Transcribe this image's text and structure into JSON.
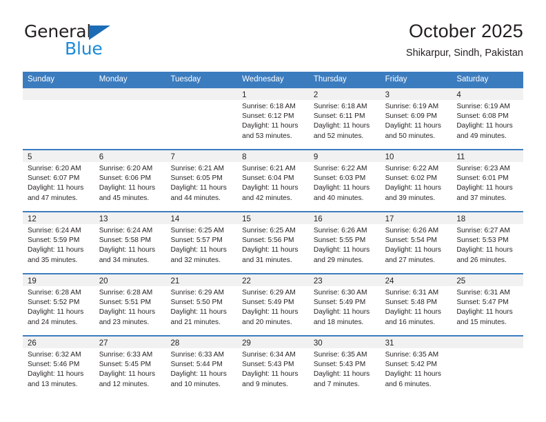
{
  "brand": {
    "name_top": "General",
    "name_bottom": "Blue",
    "accent_color": "#1b8ad6",
    "triangle_color": "#1b6cb5"
  },
  "header": {
    "title": "October 2025",
    "subtitle": "Shikarpur, Sindh, Pakistan"
  },
  "theme": {
    "header_row_bg": "#3b7cbf",
    "day_strip_bg": "#f1f1f1",
    "text_color": "#231f20"
  },
  "weekdays": [
    "Sunday",
    "Monday",
    "Tuesday",
    "Wednesday",
    "Thursday",
    "Friday",
    "Saturday"
  ],
  "weeks": [
    [
      {
        "day": "",
        "empty": true
      },
      {
        "day": "",
        "empty": true
      },
      {
        "day": "",
        "empty": true
      },
      {
        "day": "1",
        "sunrise": "Sunrise: 6:18 AM",
        "sunset": "Sunset: 6:12 PM",
        "daylight1": "Daylight: 11 hours",
        "daylight2": "and 53 minutes."
      },
      {
        "day": "2",
        "sunrise": "Sunrise: 6:18 AM",
        "sunset": "Sunset: 6:11 PM",
        "daylight1": "Daylight: 11 hours",
        "daylight2": "and 52 minutes."
      },
      {
        "day": "3",
        "sunrise": "Sunrise: 6:19 AM",
        "sunset": "Sunset: 6:09 PM",
        "daylight1": "Daylight: 11 hours",
        "daylight2": "and 50 minutes."
      },
      {
        "day": "4",
        "sunrise": "Sunrise: 6:19 AM",
        "sunset": "Sunset: 6:08 PM",
        "daylight1": "Daylight: 11 hours",
        "daylight2": "and 49 minutes."
      }
    ],
    [
      {
        "day": "5",
        "sunrise": "Sunrise: 6:20 AM",
        "sunset": "Sunset: 6:07 PM",
        "daylight1": "Daylight: 11 hours",
        "daylight2": "and 47 minutes."
      },
      {
        "day": "6",
        "sunrise": "Sunrise: 6:20 AM",
        "sunset": "Sunset: 6:06 PM",
        "daylight1": "Daylight: 11 hours",
        "daylight2": "and 45 minutes."
      },
      {
        "day": "7",
        "sunrise": "Sunrise: 6:21 AM",
        "sunset": "Sunset: 6:05 PM",
        "daylight1": "Daylight: 11 hours",
        "daylight2": "and 44 minutes."
      },
      {
        "day": "8",
        "sunrise": "Sunrise: 6:21 AM",
        "sunset": "Sunset: 6:04 PM",
        "daylight1": "Daylight: 11 hours",
        "daylight2": "and 42 minutes."
      },
      {
        "day": "9",
        "sunrise": "Sunrise: 6:22 AM",
        "sunset": "Sunset: 6:03 PM",
        "daylight1": "Daylight: 11 hours",
        "daylight2": "and 40 minutes."
      },
      {
        "day": "10",
        "sunrise": "Sunrise: 6:22 AM",
        "sunset": "Sunset: 6:02 PM",
        "daylight1": "Daylight: 11 hours",
        "daylight2": "and 39 minutes."
      },
      {
        "day": "11",
        "sunrise": "Sunrise: 6:23 AM",
        "sunset": "Sunset: 6:01 PM",
        "daylight1": "Daylight: 11 hours",
        "daylight2": "and 37 minutes."
      }
    ],
    [
      {
        "day": "12",
        "sunrise": "Sunrise: 6:24 AM",
        "sunset": "Sunset: 5:59 PM",
        "daylight1": "Daylight: 11 hours",
        "daylight2": "and 35 minutes."
      },
      {
        "day": "13",
        "sunrise": "Sunrise: 6:24 AM",
        "sunset": "Sunset: 5:58 PM",
        "daylight1": "Daylight: 11 hours",
        "daylight2": "and 34 minutes."
      },
      {
        "day": "14",
        "sunrise": "Sunrise: 6:25 AM",
        "sunset": "Sunset: 5:57 PM",
        "daylight1": "Daylight: 11 hours",
        "daylight2": "and 32 minutes."
      },
      {
        "day": "15",
        "sunrise": "Sunrise: 6:25 AM",
        "sunset": "Sunset: 5:56 PM",
        "daylight1": "Daylight: 11 hours",
        "daylight2": "and 31 minutes."
      },
      {
        "day": "16",
        "sunrise": "Sunrise: 6:26 AM",
        "sunset": "Sunset: 5:55 PM",
        "daylight1": "Daylight: 11 hours",
        "daylight2": "and 29 minutes."
      },
      {
        "day": "17",
        "sunrise": "Sunrise: 6:26 AM",
        "sunset": "Sunset: 5:54 PM",
        "daylight1": "Daylight: 11 hours",
        "daylight2": "and 27 minutes."
      },
      {
        "day": "18",
        "sunrise": "Sunrise: 6:27 AM",
        "sunset": "Sunset: 5:53 PM",
        "daylight1": "Daylight: 11 hours",
        "daylight2": "and 26 minutes."
      }
    ],
    [
      {
        "day": "19",
        "sunrise": "Sunrise: 6:28 AM",
        "sunset": "Sunset: 5:52 PM",
        "daylight1": "Daylight: 11 hours",
        "daylight2": "and 24 minutes."
      },
      {
        "day": "20",
        "sunrise": "Sunrise: 6:28 AM",
        "sunset": "Sunset: 5:51 PM",
        "daylight1": "Daylight: 11 hours",
        "daylight2": "and 23 minutes."
      },
      {
        "day": "21",
        "sunrise": "Sunrise: 6:29 AM",
        "sunset": "Sunset: 5:50 PM",
        "daylight1": "Daylight: 11 hours",
        "daylight2": "and 21 minutes."
      },
      {
        "day": "22",
        "sunrise": "Sunrise: 6:29 AM",
        "sunset": "Sunset: 5:49 PM",
        "daylight1": "Daylight: 11 hours",
        "daylight2": "and 20 minutes."
      },
      {
        "day": "23",
        "sunrise": "Sunrise: 6:30 AM",
        "sunset": "Sunset: 5:49 PM",
        "daylight1": "Daylight: 11 hours",
        "daylight2": "and 18 minutes."
      },
      {
        "day": "24",
        "sunrise": "Sunrise: 6:31 AM",
        "sunset": "Sunset: 5:48 PM",
        "daylight1": "Daylight: 11 hours",
        "daylight2": "and 16 minutes."
      },
      {
        "day": "25",
        "sunrise": "Sunrise: 6:31 AM",
        "sunset": "Sunset: 5:47 PM",
        "daylight1": "Daylight: 11 hours",
        "daylight2": "and 15 minutes."
      }
    ],
    [
      {
        "day": "26",
        "sunrise": "Sunrise: 6:32 AM",
        "sunset": "Sunset: 5:46 PM",
        "daylight1": "Daylight: 11 hours",
        "daylight2": "and 13 minutes."
      },
      {
        "day": "27",
        "sunrise": "Sunrise: 6:33 AM",
        "sunset": "Sunset: 5:45 PM",
        "daylight1": "Daylight: 11 hours",
        "daylight2": "and 12 minutes."
      },
      {
        "day": "28",
        "sunrise": "Sunrise: 6:33 AM",
        "sunset": "Sunset: 5:44 PM",
        "daylight1": "Daylight: 11 hours",
        "daylight2": "and 10 minutes."
      },
      {
        "day": "29",
        "sunrise": "Sunrise: 6:34 AM",
        "sunset": "Sunset: 5:43 PM",
        "daylight1": "Daylight: 11 hours",
        "daylight2": "and 9 minutes."
      },
      {
        "day": "30",
        "sunrise": "Sunrise: 6:35 AM",
        "sunset": "Sunset: 5:43 PM",
        "daylight1": "Daylight: 11 hours",
        "daylight2": "and 7 minutes."
      },
      {
        "day": "31",
        "sunrise": "Sunrise: 6:35 AM",
        "sunset": "Sunset: 5:42 PM",
        "daylight1": "Daylight: 11 hours",
        "daylight2": "and 6 minutes."
      },
      {
        "day": "",
        "empty": true
      }
    ]
  ]
}
